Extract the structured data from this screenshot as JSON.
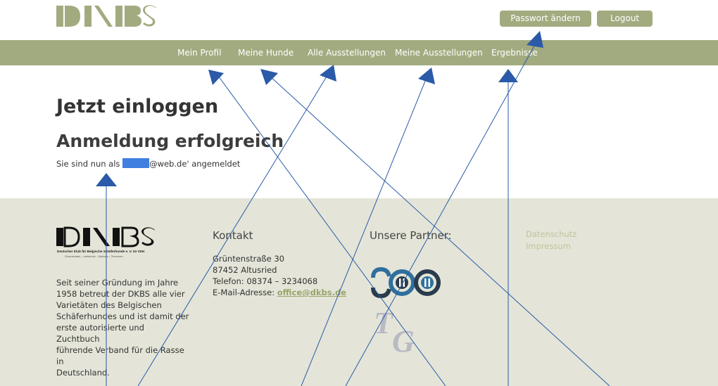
{
  "header": {
    "logo_text": "DKBS",
    "password_button": "Passwort ändern",
    "logout_button": "Logout"
  },
  "nav": {
    "items": [
      {
        "label": "Mein Profil"
      },
      {
        "label": "Meine Hunde"
      },
      {
        "label": "Alle Ausstellungen"
      },
      {
        "label": "Meine Ausstellungen"
      },
      {
        "label": "Ergebnisse"
      }
    ]
  },
  "main": {
    "title": "Jetzt einloggen",
    "subtitle": "Anmeldung erfolgreich",
    "message_prefix": "Sie sind nun als ",
    "message_suffix": "@web.de' angemeldet"
  },
  "footer": {
    "logo_text": "DKBS",
    "logo_subtitle": "Deutscher Klub für Belgische Schäferhunde e. V. im VDH",
    "logo_varieties": "Groenendael – Laekenois – Malinois – Tervueren",
    "about_lines": [
      "Seit seiner Gründung im Jahre",
      "1958 betreut der DKBS alle vier",
      "Varietäten des Belgischen",
      "Schäferhundes und ist damit der",
      "erste autorisierte und Zuchtbuch",
      "führende Verband für die Rasse in",
      "Deutschland."
    ],
    "contact_heading": "Kontakt",
    "address_street": "Grüntenstraße 30",
    "address_city": "87452 Altusried",
    "phone": "Telefon: 08374 – 3234068",
    "email_label": "E-Mail-Adresse: ",
    "email": "office@dkbs.de",
    "partners_heading": "Unsere Partner:",
    "partner_logo_2": "TG",
    "privacy_link": "Datenschutz",
    "imprint_link": "Impressum"
  },
  "colors": {
    "accent": "#a2ab80",
    "footer_bg": "#e4e5d8",
    "arrow": "#2a5aa8",
    "redaction": "#3f7fe0"
  }
}
